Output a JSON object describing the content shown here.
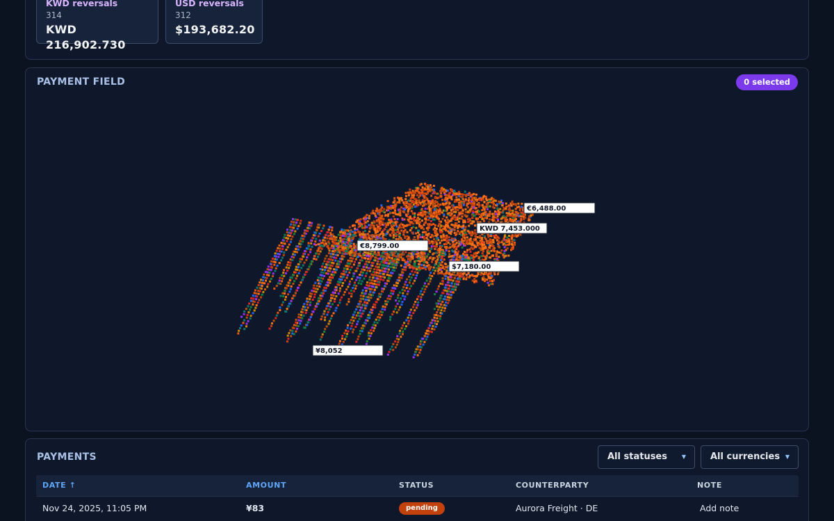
{
  "summary": {
    "cards": [
      {
        "title": "KWD reversals",
        "count": "314",
        "amount": "KWD 216,902.730"
      },
      {
        "title": "USD reversals",
        "count": "312",
        "amount": "$193,682.20"
      }
    ]
  },
  "field": {
    "title": "PAYMENT FIELD",
    "selected_badge": "0 selected",
    "callouts": [
      "€6,488.00",
      "KWD 7,453.000",
      "€8,799.00",
      "$7,180.00",
      "¥8,052"
    ],
    "point_colors": [
      "#ea580c",
      "#c2410c",
      "#f97316",
      "#ca8a04",
      "#15803d",
      "#9333ea",
      "#2563eb",
      "#b45309",
      "#0f766e",
      "#dc2626"
    ]
  },
  "payments": {
    "title": "PAYMENTS",
    "status_filter": "All statuses",
    "currency_filter": "All currencies",
    "columns": {
      "date": "DATE ↑",
      "amount": "AMOUNT",
      "status": "STATUS",
      "counterparty": "COUNTERPARTY",
      "note": "NOTE"
    },
    "rows": [
      {
        "date": "Nov 24, 2025, 11:05 PM",
        "amount": "¥83",
        "status": "pending",
        "counterparty": "Aurora Freight · DE",
        "note": "Add note"
      }
    ]
  }
}
